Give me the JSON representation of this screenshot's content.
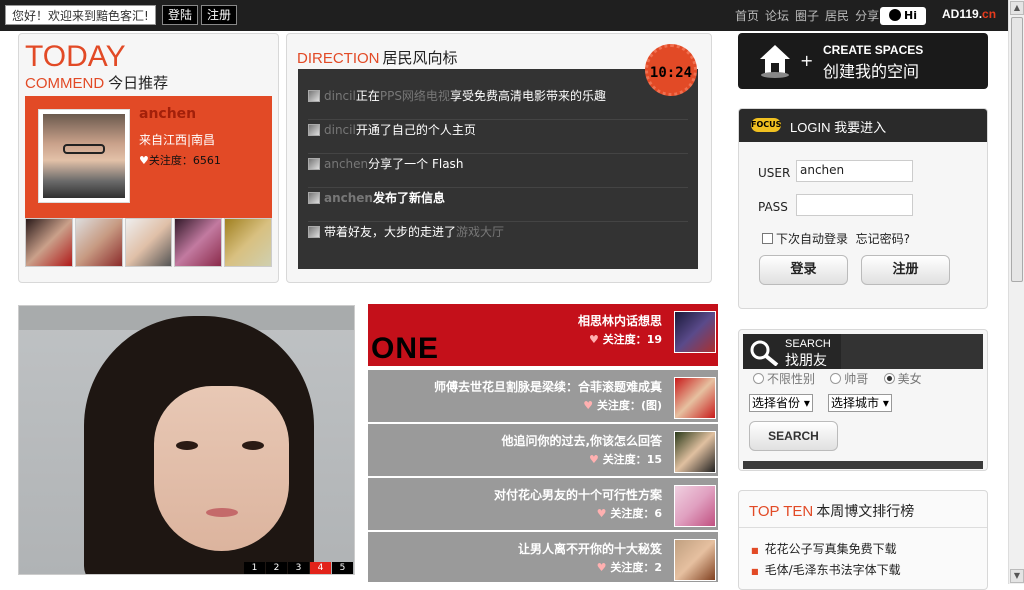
{
  "topbar": {
    "welcome": "您好！欢迎来到黯色客汇!",
    "login_btn": "登陆",
    "register_btn": "注册",
    "nav": [
      "首页",
      "论坛",
      "圈子",
      "居民",
      "分享"
    ],
    "hi_badge": "Hi",
    "logo_main": "AD119.",
    "logo_cn": "cn"
  },
  "today": {
    "title": "TODAY",
    "commend_en": "COMMEND",
    "commend_cn": "今日推荐",
    "profile": {
      "name": "anchen",
      "location": "来自江西|南昌",
      "follow_label": "关注度：",
      "follow_count": "6561"
    }
  },
  "direction": {
    "title_en": "DIRECTION",
    "title_cn": "居民风向标",
    "clock": "10:24",
    "items": [
      {
        "user": "dincil",
        "action": "正在",
        "highlight": "PPS网络电视",
        "rest": "享受免费高清电影带来的乐趣"
      },
      {
        "user": "dincil",
        "action": "开通了自己的个人主页",
        "highlight": "",
        "rest": ""
      },
      {
        "user": "anchen",
        "action": "分享了一个  Flash",
        "highlight": "",
        "rest": ""
      },
      {
        "user": "anchen",
        "action": "发布了新信息",
        "highlight": "",
        "rest": ""
      },
      {
        "user": "",
        "action": "带着好友，大步的走进了",
        "highlight": "游戏大厅",
        "rest": ""
      }
    ]
  },
  "create_space": {
    "en": "CREATE SPACES",
    "plus": "+",
    "cn": "创建我的空间"
  },
  "login": {
    "badge": "FOCUS",
    "title": "LOGIN 我要进入",
    "user_label": "USER",
    "user_value": "anchen",
    "pass_label": "PASS",
    "pass_value": "",
    "remember": "下次自动登录",
    "forgot": "忘记密码?",
    "login_btn": "登录",
    "register_btn": "注册"
  },
  "search": {
    "title_en": "SEARCH",
    "title_cn": "找朋友",
    "radios": [
      "不限性别",
      "帅哥",
      "美女"
    ],
    "selected_radio": 2,
    "province": "选择省份",
    "city": "选择城市",
    "button": "SEARCH"
  },
  "topten": {
    "title_en": "TOP TEN",
    "title_cn": "本周博文排行榜",
    "items": [
      "花花公子写真集免费下载",
      "毛体/毛泽东书法字体下载"
    ]
  },
  "photo": {
    "pages": [
      "1",
      "2",
      "3",
      "4",
      "5"
    ],
    "active_page": 3
  },
  "one_list": {
    "label": "ONE",
    "follow_label": "关注度：",
    "items": [
      {
        "title": "相思林内话想思",
        "count": "19"
      },
      {
        "title": "师傅去世花旦割脉是梁续：合菲滚题难成真",
        "count": "(图)"
      },
      {
        "title": "他追问你的过去,你该怎么回答",
        "count": "15"
      },
      {
        "title": "对付花心男友的十个可行性方案",
        "count": "6"
      },
      {
        "title": "让男人离不开你的十大秘笈",
        "count": "2"
      }
    ]
  }
}
